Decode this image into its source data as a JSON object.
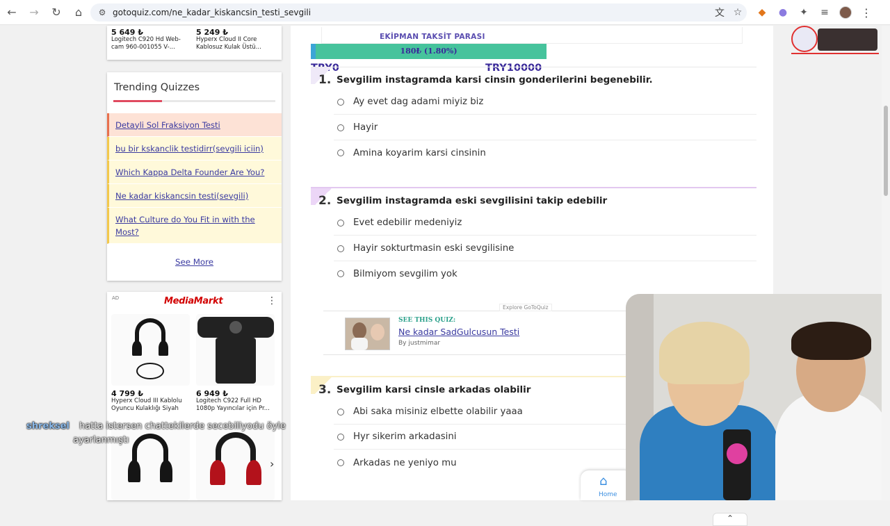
{
  "browser": {
    "url": "gotoquiz.com/ne_kadar_kiskancsin_testi_sevgili",
    "icons": [
      "back-icon",
      "forward-icon",
      "reload-icon",
      "home-icon",
      "site-settings-icon",
      "translate-icon",
      "bookmark-star-icon",
      "extensions-puzzle-icon",
      "media-control-icon",
      "profile-avatar",
      "more-menu-icon"
    ]
  },
  "sidebar": {
    "top_products": [
      {
        "price": "5 649 ₺",
        "name": "Logitech C920 Hd Web-cam 960-001055 V-..."
      },
      {
        "price": "5 249 ₺",
        "name": "Hyperx Cloud II Core Kablosuz Kulak Üstü..."
      }
    ],
    "trending_title": "Trending Quizzes",
    "trending": [
      "Detayli Sol Fraksiyon Testi",
      "bu bir kskanclik testidirr(sevgili iciin)",
      "Which Kappa Delta Founder Are You?",
      "Ne kadar kiskancsin testi(sevgili)",
      "What Culture do You Fit in with the Most?"
    ],
    "see_more": "See More",
    "ad": {
      "label": "AD",
      "brand": "MediaMarkt",
      "products": [
        {
          "price": "4 799 ₺",
          "name": "Hyperx Cloud III Kablolu Oyuncu Kulaklığı Siyah"
        },
        {
          "price": "6 949 ₺",
          "name": "Logitech C922 Full HD 1080p Yayıncılar için Pr..."
        }
      ]
    }
  },
  "main": {
    "taksit_title": "EKİPMAN TAKSİT PARASI",
    "progress_label": "180₺ (1.80%)",
    "progress_fraction": 0.018,
    "range_min": "TRY0",
    "range_max": "TRY10000",
    "questions": [
      {
        "num": "1.",
        "text": "Sevgilim instagramda karsi cinsin gonderilerini begenebilir.",
        "options": [
          "Ay evet dag adami miyiz biz",
          "Hayir",
          "Amina koyarim karsi cinsinin"
        ]
      },
      {
        "num": "2.",
        "text": "Sevgilim instagramda eski sevgilisini takip edebilir",
        "options": [
          "Evet edebilir medeniyiz",
          "Hayir sokturtmasin eski sevgilisine",
          "Bilmiyom sevgilim yok"
        ]
      },
      {
        "num": "3.",
        "text": "Sevgilim karsi cinsle arkadas olabilir",
        "options": [
          "Abi saka misiniz elbette olabilir yaaa",
          "Hyr sikerim arkadasini",
          "Arkadas ne yeniyo mu"
        ]
      }
    ],
    "promo": {
      "explore": "Explore GoToQuiz",
      "see_label": "SEE THIS QUIZ:",
      "title": "Ne kadar SadGulcusun Testi",
      "by": "By justmimar"
    },
    "home_label": "Home"
  },
  "stream": {
    "chat_user": "shreksel",
    "chat_line1": "hatta istersen chattekilerde secebiliyodu öyle",
    "chat_line2": "ayarlanmıştı"
  },
  "colors": {
    "accent_purple": "#3a2a9a",
    "progress_green": "#46c39c",
    "trending_red": "#e04a5f"
  }
}
